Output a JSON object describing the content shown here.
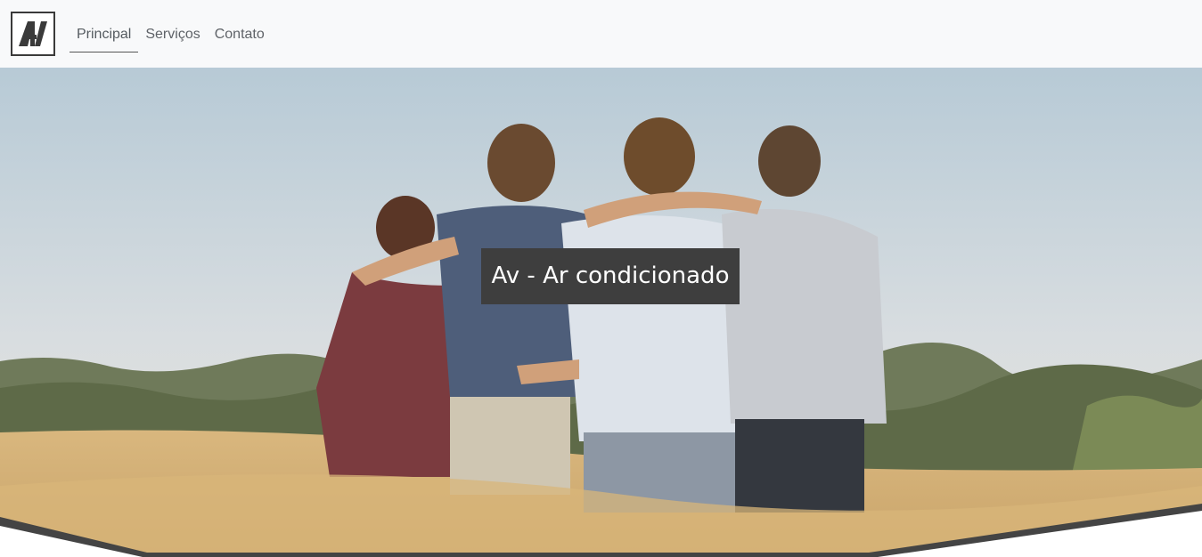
{
  "brand": {
    "logo_text": "AV",
    "logo_icon": "av-logo-icon"
  },
  "nav": {
    "items": [
      {
        "label": "Principal",
        "active": true
      },
      {
        "label": "Serviços",
        "active": false
      },
      {
        "label": "Contato",
        "active": false
      }
    ]
  },
  "hero": {
    "title": "Av - Ar condicionado"
  },
  "colors": {
    "navbar_bg": "#f8f9fa",
    "title_bg": "#3e3e3e",
    "title_text": "#ffffff",
    "divider": "#444444"
  }
}
